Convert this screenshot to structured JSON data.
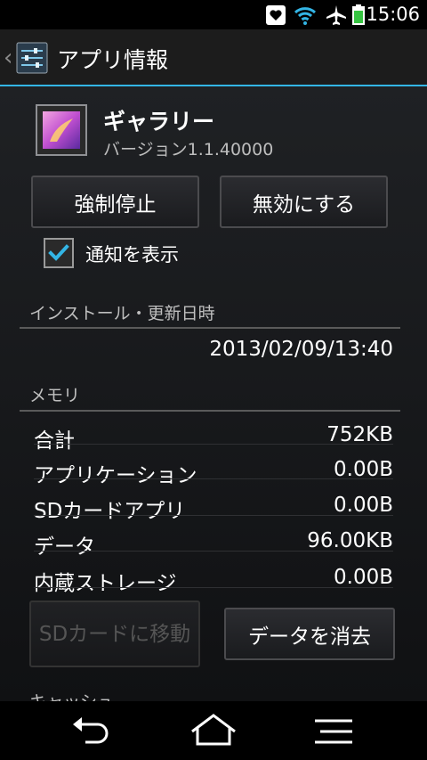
{
  "status_bar": {
    "time": "15:06",
    "icons": [
      "heart-notification-icon",
      "wifi-icon",
      "airplane-icon",
      "battery-icon"
    ]
  },
  "action_bar": {
    "title": "アプリ情報"
  },
  "app": {
    "name": "ギャラリー",
    "version": "バージョン1.1.40000"
  },
  "buttons": {
    "force_stop": "強制停止",
    "disable": "無効にする",
    "move_to_sd": "SDカードに移動",
    "clear_data": "データを消去"
  },
  "notifications": {
    "label": "通知を表示",
    "checked": true
  },
  "install_section": {
    "header": "インストール・更新日時",
    "datetime": "2013/02/09/13:40"
  },
  "memory_section": {
    "header": "メモリ",
    "rows": [
      {
        "label": "合計",
        "value": "752KB"
      },
      {
        "label": "アプリケーション",
        "value": "0.00B"
      },
      {
        "label": "SDカードアプリ",
        "value": "0.00B"
      },
      {
        "label": "データ",
        "value": "96.00KB"
      },
      {
        "label": "内蔵ストレージ",
        "value": "0.00B"
      }
    ]
  },
  "cache_section": {
    "header": "キャッシュ"
  },
  "colors": {
    "accent": "#33b5e5",
    "background": "#16171a",
    "text": "#ffffff",
    "secondary_text": "#bfbfbf"
  }
}
